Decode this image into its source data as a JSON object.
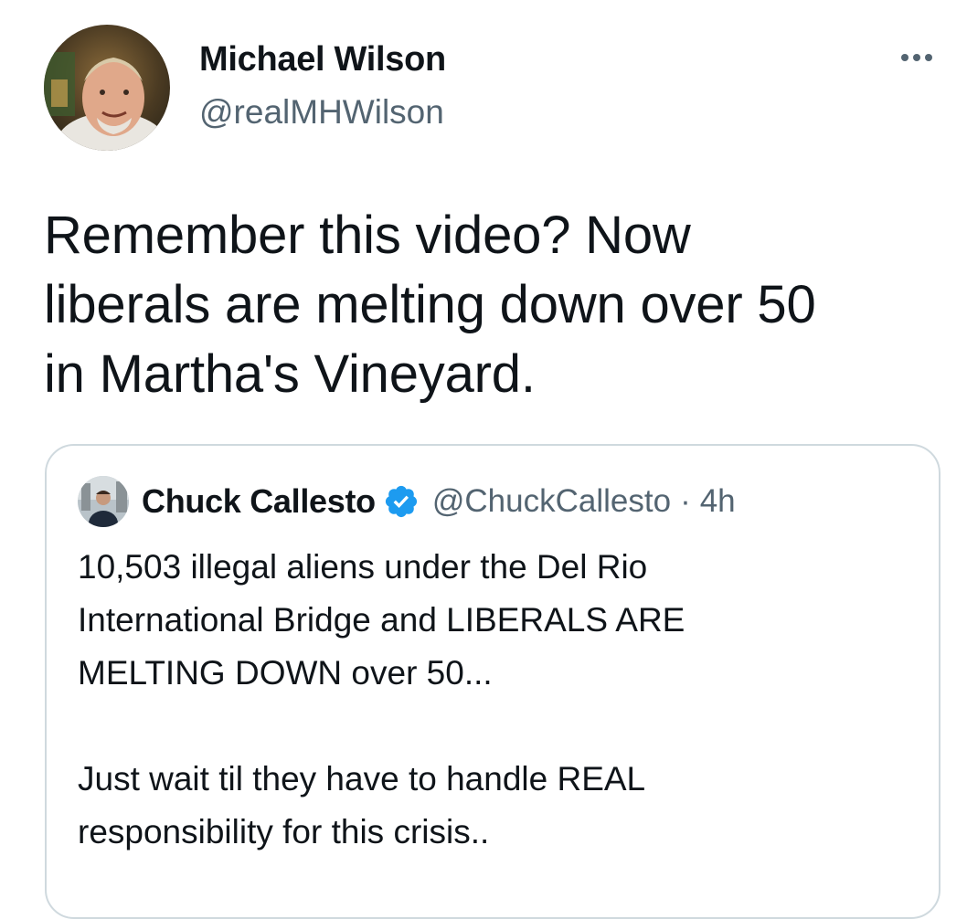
{
  "tweet": {
    "author": {
      "name": "Michael Wilson",
      "handle": "@realMHWilson"
    },
    "text": "Remember this video? Now\nliberals are melting down over 50\nin Martha's Vineyard.",
    "more_icon": "more-horizontal-icon"
  },
  "quoted_tweet": {
    "author": {
      "name": "Chuck Callesto",
      "handle": "@ChuckCallesto",
      "verified": true
    },
    "separator": "·",
    "time": "4h",
    "text": "10,503 illegal aliens under the Del Rio\nInternational Bridge and LIBERALS ARE\nMELTING DOWN over 50...\n\nJust wait til they have to handle REAL\nresponsibility for this crisis.."
  },
  "colors": {
    "text_primary": "#0f1419",
    "text_secondary": "#536471",
    "card_border": "#cfd9de",
    "verified_blue": "#1d9bf0"
  }
}
